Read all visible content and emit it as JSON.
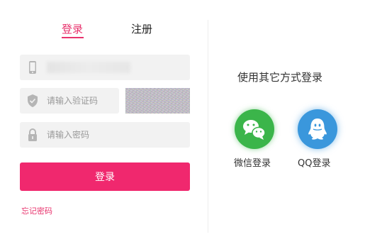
{
  "tabs": {
    "login": "登录",
    "register": "注册"
  },
  "form": {
    "phone": {
      "value": "",
      "icon": "phone-icon"
    },
    "captcha": {
      "placeholder": "请输入验证码",
      "icon": "shield-icon"
    },
    "password": {
      "placeholder": "请输入密码",
      "icon": "lock-icon"
    },
    "submit_label": "登录",
    "forgot_label": "忘记密码"
  },
  "other": {
    "title": "使用其它方式登录",
    "wechat_label": "微信登录",
    "qq_label": "QQ登录"
  },
  "colors": {
    "accent": "#f0286e",
    "wechat": "#3bb54a",
    "qq": "#3a97dc"
  }
}
